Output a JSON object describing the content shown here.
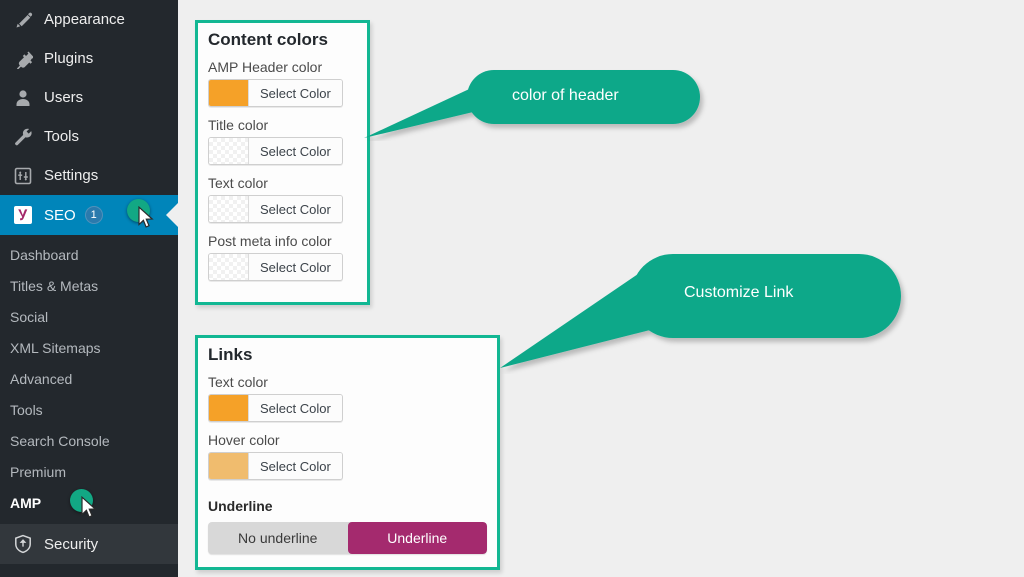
{
  "theme": {
    "sidebar_bg": "#23282d",
    "sidebar_active_bg": "#0085ba",
    "panel_border": "#12b793",
    "callout_bg": "#0fa889",
    "page_bg": "#efefef",
    "toggle_selected_bg": "#a42a6e"
  },
  "sidebar": {
    "top_items": [
      {
        "label": "Appearance",
        "icon": "brush-icon",
        "active": false
      },
      {
        "label": "Plugins",
        "icon": "plug-icon",
        "active": false
      },
      {
        "label": "Users",
        "icon": "user-icon",
        "active": false
      },
      {
        "label": "Tools",
        "icon": "wrench-icon",
        "active": false
      },
      {
        "label": "Settings",
        "icon": "sliders-icon",
        "active": false
      }
    ],
    "active_item": {
      "label": "SEO",
      "icon": "yoast-logo-icon",
      "badge": "1"
    },
    "submenu": [
      {
        "label": "Dashboard",
        "current": false
      },
      {
        "label": "Titles & Metas",
        "current": false
      },
      {
        "label": "Social",
        "current": false
      },
      {
        "label": "XML Sitemaps",
        "current": false
      },
      {
        "label": "Advanced",
        "current": false
      },
      {
        "label": "Tools",
        "current": false
      },
      {
        "label": "Search Console",
        "current": false
      },
      {
        "label": "Premium",
        "current": false
      },
      {
        "label": "AMP",
        "current": true
      }
    ],
    "bottom_item": {
      "label": "Security",
      "icon": "shield-icon"
    }
  },
  "content_colors_panel": {
    "title": "Content colors",
    "fields": [
      {
        "label": "AMP Header color",
        "button": "Select Color",
        "swatch": "#f5a128",
        "empty": false
      },
      {
        "label": "Title color",
        "button": "Select Color",
        "swatch": "",
        "empty": true
      },
      {
        "label": "Text color",
        "button": "Select Color",
        "swatch": "",
        "empty": true
      },
      {
        "label": "Post meta info color",
        "button": "Select Color",
        "swatch": "",
        "empty": true
      }
    ]
  },
  "links_panel": {
    "title": "Links",
    "fields": [
      {
        "label": "Text color",
        "button": "Select Color",
        "swatch": "#f5a128",
        "empty": false
      },
      {
        "label": "Hover color",
        "button": "Select Color",
        "swatch": "#f0bc6e",
        "empty": false
      }
    ],
    "underline": {
      "label": "Underline",
      "options": [
        {
          "label": "No underline",
          "selected": false
        },
        {
          "label": "Underline",
          "selected": true
        }
      ]
    }
  },
  "callouts": [
    {
      "text": "color of header"
    },
    {
      "text": "Customize Link"
    }
  ]
}
